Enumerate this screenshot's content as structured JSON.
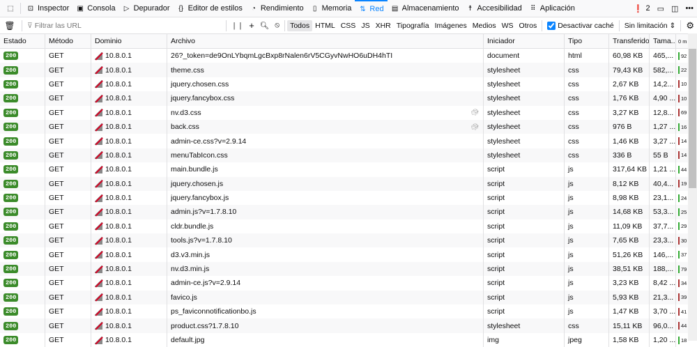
{
  "toolbar": {
    "tabs": [
      {
        "label": "Inspector",
        "icon": "inspector-icon",
        "g": "⊡"
      },
      {
        "label": "Consola",
        "icon": "console-icon",
        "g": "▣"
      },
      {
        "label": "Depurador",
        "icon": "debugger-icon",
        "g": "▷"
      },
      {
        "label": "Editor de estilos",
        "icon": "style-editor-icon",
        "g": "{}"
      },
      {
        "label": "Rendimiento",
        "icon": "performance-icon",
        "g": "◔"
      },
      {
        "label": "Memoria",
        "icon": "memory-icon",
        "g": "▯"
      },
      {
        "label": "Red",
        "icon": "network-icon",
        "g": "⇅"
      },
      {
        "label": "Almacenamiento",
        "icon": "storage-icon",
        "g": "▤"
      },
      {
        "label": "Accesibilidad",
        "icon": "accessibility-icon",
        "g": "☨"
      },
      {
        "label": "Aplicación",
        "icon": "application-icon",
        "g": "⠿"
      }
    ],
    "error_count": "2"
  },
  "filter": {
    "placeholder": "Filtrar las URL",
    "types": [
      "Todos",
      "HTML",
      "CSS",
      "JS",
      "XHR",
      "Tipografía",
      "Imágenes",
      "Medios",
      "WS",
      "Otros"
    ],
    "disable_cache": "Desactivar caché",
    "throttling": "Sin limitación"
  },
  "columns": [
    "Estado",
    "Método",
    "Dominio",
    "Archivo",
    "Iniciador",
    "Tipo",
    "Transferido",
    "Tama...",
    "0 m"
  ],
  "colors": {
    "status_ok": "#3b8b2a",
    "accent": "#0a84ff"
  },
  "rows": [
    {
      "s": "200",
      "m": "GET",
      "d": "10.8.0.1",
      "f": "26?_token=de9OnLYbqmLgcBxp8rNalen6rV5CGyvNwHO6uDH4hTI",
      "i": "document",
      "t": "html",
      "tr": "60,98 KB",
      "sz": "465,...",
      "w": "92",
      "slow": false
    },
    {
      "s": "200",
      "m": "GET",
      "d": "10.8.0.1",
      "f": "theme.css",
      "i": "stylesheet",
      "t": "css",
      "tr": "79,43 KB",
      "sz": "582,...",
      "w": "22",
      "slow": false
    },
    {
      "s": "200",
      "m": "GET",
      "d": "10.8.0.1",
      "f": "jquery.chosen.css",
      "i": "stylesheet",
      "t": "css",
      "tr": "2,67 KB",
      "sz": "14,2...",
      "w": "10",
      "slow": false
    },
    {
      "s": "200",
      "m": "GET",
      "d": "10.8.0.1",
      "f": "jquery.fancybox.css",
      "i": "stylesheet",
      "t": "css",
      "tr": "1,76 KB",
      "sz": "4,90 ...",
      "w": "10",
      "slow": false
    },
    {
      "s": "200",
      "m": "GET",
      "d": "10.8.0.1",
      "f": "nv.d3.css",
      "i": "stylesheet",
      "t": "css",
      "tr": "3,27 KB",
      "sz": "12,8...",
      "w": "69",
      "slow": true
    },
    {
      "s": "200",
      "m": "GET",
      "d": "10.8.0.1",
      "f": "back.css",
      "i": "stylesheet",
      "t": "css",
      "tr": "976 B",
      "sz": "1,27 ...",
      "w": "16",
      "slow": true
    },
    {
      "s": "200",
      "m": "GET",
      "d": "10.8.0.1",
      "f": "admin-ce.css?v=2.9.14",
      "i": "stylesheet",
      "t": "css",
      "tr": "1,46 KB",
      "sz": "3,27 ...",
      "w": "14",
      "slow": false
    },
    {
      "s": "200",
      "m": "GET",
      "d": "10.8.0.1",
      "f": "menuTabIcon.css",
      "i": "stylesheet",
      "t": "css",
      "tr": "336 B",
      "sz": "55 B",
      "w": "14",
      "slow": false
    },
    {
      "s": "200",
      "m": "GET",
      "d": "10.8.0.1",
      "f": "main.bundle.js",
      "i": "script",
      "t": "js",
      "tr": "317,64 KB",
      "sz": "1,21 ...",
      "w": "44",
      "slow": false
    },
    {
      "s": "200",
      "m": "GET",
      "d": "10.8.0.1",
      "f": "jquery.chosen.js",
      "i": "script",
      "t": "js",
      "tr": "8,12 KB",
      "sz": "40,4...",
      "w": "19",
      "slow": false
    },
    {
      "s": "200",
      "m": "GET",
      "d": "10.8.0.1",
      "f": "jquery.fancybox.js",
      "i": "script",
      "t": "js",
      "tr": "8,98 KB",
      "sz": "23,1...",
      "w": "24",
      "slow": false
    },
    {
      "s": "200",
      "m": "GET",
      "d": "10.8.0.1",
      "f": "admin.js?v=1.7.8.10",
      "i": "script",
      "t": "js",
      "tr": "14,68 KB",
      "sz": "53,3...",
      "w": "25",
      "slow": false
    },
    {
      "s": "200",
      "m": "GET",
      "d": "10.8.0.1",
      "f": "cldr.bundle.js",
      "i": "script",
      "t": "js",
      "tr": "11,09 KB",
      "sz": "37,7...",
      "w": "29",
      "slow": false
    },
    {
      "s": "200",
      "m": "GET",
      "d": "10.8.0.1",
      "f": "tools.js?v=1.7.8.10",
      "i": "script",
      "t": "js",
      "tr": "7,65 KB",
      "sz": "23,3...",
      "w": "30",
      "slow": false
    },
    {
      "s": "200",
      "m": "GET",
      "d": "10.8.0.1",
      "f": "d3.v3.min.js",
      "i": "script",
      "t": "js",
      "tr": "51,26 KB",
      "sz": "146,...",
      "w": "37",
      "slow": false
    },
    {
      "s": "200",
      "m": "GET",
      "d": "10.8.0.1",
      "f": "nv.d3.min.js",
      "i": "script",
      "t": "js",
      "tr": "38,51 KB",
      "sz": "188,...",
      "w": "79",
      "slow": false
    },
    {
      "s": "200",
      "m": "GET",
      "d": "10.8.0.1",
      "f": "admin-ce.js?v=2.9.14",
      "i": "script",
      "t": "js",
      "tr": "3,23 KB",
      "sz": "8,42 ...",
      "w": "34",
      "slow": false
    },
    {
      "s": "200",
      "m": "GET",
      "d": "10.8.0.1",
      "f": "favico.js",
      "i": "script",
      "t": "js",
      "tr": "5,93 KB",
      "sz": "21,3...",
      "w": "39",
      "slow": false
    },
    {
      "s": "200",
      "m": "GET",
      "d": "10.8.0.1",
      "f": "ps_faviconnotificationbo.js",
      "i": "script",
      "t": "js",
      "tr": "1,47 KB",
      "sz": "3,70 ...",
      "w": "41",
      "slow": false
    },
    {
      "s": "200",
      "m": "GET",
      "d": "10.8.0.1",
      "f": "product.css?1.7.8.10",
      "i": "stylesheet",
      "t": "css",
      "tr": "15,11 KB",
      "sz": "96,0...",
      "w": "44",
      "slow": false
    },
    {
      "s": "200",
      "m": "GET",
      "d": "10.8.0.1",
      "f": "default.jpg",
      "i": "img",
      "t": "jpeg",
      "tr": "1,58 KB",
      "sz": "1,20 ...",
      "w": "18",
      "slow": false
    }
  ]
}
